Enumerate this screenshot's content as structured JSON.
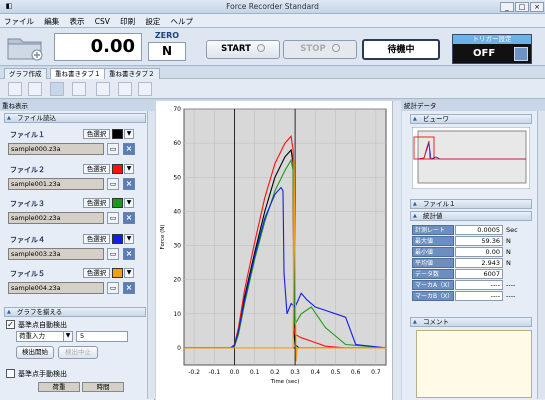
{
  "window": {
    "title": "Force Recorder Standard"
  },
  "menu": [
    "ファイル",
    "編集",
    "表示",
    "CSV",
    "印刷",
    "設定",
    "ヘルプ"
  ],
  "toolbar": {
    "value": "0.00",
    "zero_label": "ZERO",
    "unit": "N",
    "start_label": "START",
    "stop_label": "STOP",
    "status": "待機中",
    "trigger_title": "トリガー設定",
    "trigger_value": "OFF"
  },
  "tabs": [
    "グラフ作成",
    "重ね書きタブ１",
    "重ね書きタブ２"
  ],
  "left": {
    "panel_title": "重ね表示",
    "file_section": "ファイル読込",
    "color_select_label": "色選択",
    "files": [
      {
        "label": "ファイル１",
        "name": "sample000.z3a",
        "color": "#000000"
      },
      {
        "label": "ファイル２",
        "name": "sample001.z3a",
        "color": "#ff1010"
      },
      {
        "label": "ファイル３",
        "name": "sample002.z3a",
        "color": "#1a9a1a"
      },
      {
        "label": "ファイル４",
        "name": "sample003.z3a",
        "color": "#1020e0"
      },
      {
        "label": "ファイル５",
        "name": "sample004.z3a",
        "color": "#f0a010"
      }
    ],
    "graph_section": "グラフを揃える",
    "auto_check_label": "基準点自動検出",
    "mode_value": "荷重入力",
    "mode_number": "5",
    "detect_start": "検出開始",
    "detect_stop": "検出中止",
    "manual_check_label": "基準点手動検出",
    "manual_col1": "荷重",
    "manual_col2": "時間"
  },
  "right": {
    "panel_title": "統計データ",
    "preview_section": "ビューワ",
    "file_section": "ファイル１",
    "stats_section": "統計値",
    "stats": [
      {
        "key": "計測レート",
        "value": "0.0005",
        "unit": "Sec"
      },
      {
        "key": "最大値",
        "value": "59.36",
        "unit": "N"
      },
      {
        "key": "最小値",
        "value": "0.00",
        "unit": "N"
      },
      {
        "key": "平均値",
        "value": "2.943",
        "unit": "N"
      },
      {
        "key": "データ数",
        "value": "6007",
        "unit": ""
      },
      {
        "key": "マーカA（X）",
        "value": "----",
        "unit": "----"
      },
      {
        "key": "マーカB（X）",
        "value": "----",
        "unit": "----"
      }
    ],
    "comment_section": "コメント"
  },
  "colors": {
    "accent": "#5a7db4",
    "trigger_bg": "#111111",
    "chart_bg": "#d8d8d8"
  },
  "chart_data": {
    "type": "line",
    "title": "",
    "xlabel": "Time (sec)",
    "ylabel": "Force (N)",
    "xlim": [
      -0.25,
      0.75
    ],
    "ylim": [
      -5,
      70
    ],
    "xticks": [
      "-0.2",
      "-0.1",
      "0.0",
      "0.1",
      "0.2",
      "0.3",
      "0.4",
      "0.5",
      "0.6",
      "0.7"
    ],
    "yticks": [
      "0",
      "10",
      "20",
      "30",
      "40",
      "50",
      "60",
      "70"
    ],
    "grid": true,
    "series": [
      {
        "color": "#000000",
        "x": [
          -0.25,
          -0.01,
          0.0,
          0.02,
          0.05,
          0.1,
          0.15,
          0.2,
          0.25,
          0.28,
          0.29,
          0.295,
          0.3,
          0.32,
          0.4,
          0.5,
          0.6,
          0.7,
          0.75
        ],
        "y": [
          0,
          0,
          0.5,
          5,
          15,
          28,
          40,
          50,
          56,
          58,
          54,
          4,
          1,
          0,
          0,
          0,
          0,
          0,
          0
        ]
      },
      {
        "color": "#ff1010",
        "x": [
          -0.25,
          -0.02,
          0.0,
          0.02,
          0.05,
          0.1,
          0.15,
          0.2,
          0.25,
          0.28,
          0.29,
          0.293,
          0.3,
          0.33,
          0.38,
          0.45,
          0.55,
          0.75
        ],
        "y": [
          0,
          0,
          1,
          6,
          17,
          31,
          44,
          54,
          60,
          62,
          58,
          6,
          4,
          3,
          2,
          0.5,
          0,
          0
        ]
      },
      {
        "color": "#1a9a1a",
        "x": [
          -0.25,
          -0.01,
          0.0,
          0.02,
          0.05,
          0.1,
          0.15,
          0.2,
          0.25,
          0.28,
          0.29,
          0.295,
          0.3,
          0.33,
          0.38,
          0.45,
          0.55,
          0.75
        ],
        "y": [
          0,
          0,
          0.5,
          4,
          13,
          26,
          37,
          46,
          52,
          55,
          52,
          8,
          7,
          10,
          12,
          6,
          1,
          0
        ]
      },
      {
        "color": "#1020e0",
        "x": [
          -0.25,
          -0.02,
          0.0,
          0.02,
          0.05,
          0.1,
          0.15,
          0.2,
          0.23,
          0.24,
          0.245,
          0.26,
          0.28,
          0.3,
          0.33,
          0.36,
          0.4,
          0.45,
          0.5,
          0.55,
          0.6,
          0.75
        ],
        "y": [
          0,
          0,
          0.8,
          5,
          14,
          27,
          38,
          45,
          47,
          46,
          22,
          10,
          13,
          12,
          16,
          14,
          12,
          11,
          10,
          9,
          1,
          0
        ]
      },
      {
        "color": "#f0a010",
        "x": [
          -0.25,
          0.29,
          0.295,
          0.3,
          0.305,
          0.31,
          0.75
        ],
        "y": [
          0,
          0,
          55,
          25,
          -4,
          0,
          0
        ]
      }
    ]
  }
}
